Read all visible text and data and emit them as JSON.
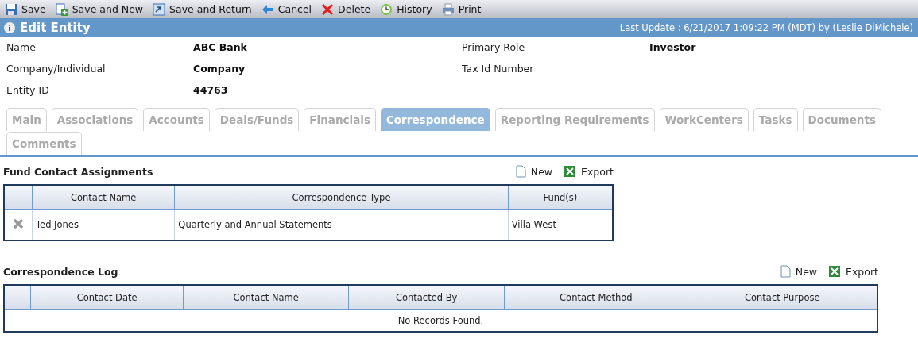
{
  "toolbar": [
    {
      "kind": "save",
      "label": "Save"
    },
    {
      "kind": "save-new",
      "label": "Save and New"
    },
    {
      "kind": "save-return",
      "label": "Save and Return"
    },
    {
      "kind": "cancel",
      "label": "Cancel"
    },
    {
      "kind": "delete",
      "label": "Delete"
    },
    {
      "kind": "history",
      "label": "History"
    },
    {
      "kind": "print",
      "label": "Print"
    }
  ],
  "header": {
    "title": "Edit Entity",
    "last_update": "Last Update : 6/21/2017 1:09:22 PM (MDT) by (Leslie DiMichele)"
  },
  "fields": [
    {
      "label": "Name",
      "value": "ABC Bank",
      "label_2": "Primary Role",
      "value_2": "Investor"
    },
    {
      "label": "Company/Individual",
      "value": "Company",
      "label_2": "Tax Id Number"
    },
    {
      "label": "Entity ID",
      "value": "44763"
    }
  ],
  "tabs": [
    {
      "label": "Main",
      "selected": false
    },
    {
      "label": "Associations",
      "selected": false
    },
    {
      "label": "Accounts",
      "selected": false
    },
    {
      "label": "Deals/Funds",
      "selected": false
    },
    {
      "label": "Financials",
      "selected": false
    },
    {
      "label": "Correspondence",
      "selected": true
    },
    {
      "label": "Reporting Requirements",
      "selected": false
    },
    {
      "label": "WorkCenters",
      "selected": false
    },
    {
      "label": "Tasks",
      "selected": false
    },
    {
      "label": "Documents",
      "selected": false
    },
    {
      "label": "Comments",
      "selected": false
    }
  ],
  "sections": [
    {
      "title": "Fund Contact Assignments",
      "actions": [
        "New",
        "Export"
      ],
      "columns": [
        "Contact Name",
        "Correspondence Type",
        "Fund(s)"
      ],
      "rows": [
        [
          "Ted Jones",
          "Quarterly and Annual Statements",
          "Villa West"
        ]
      ]
    },
    {
      "title": "Correspondence Log",
      "actions": [
        "New",
        "Export"
      ],
      "columns": [
        "Contact Date",
        "Contact Name",
        "Contacted By",
        "Contact Method",
        "Contact Purpose"
      ],
      "empty_text": "No Records Found."
    }
  ]
}
